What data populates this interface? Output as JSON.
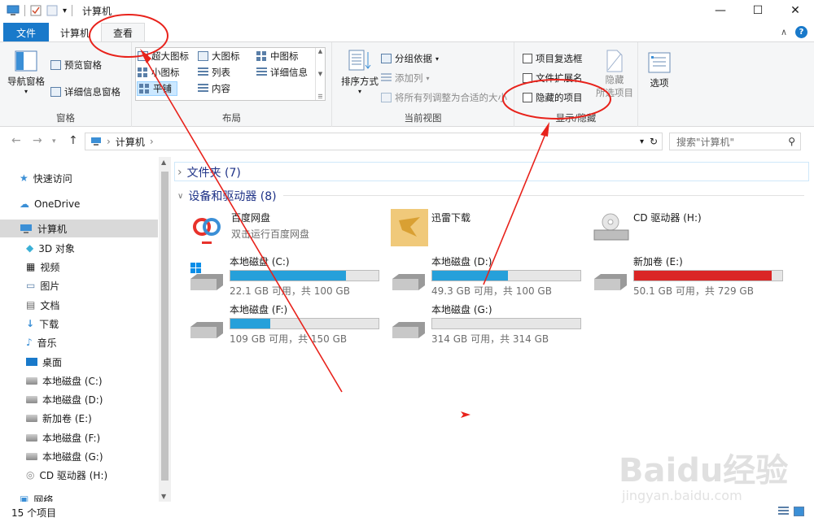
{
  "window": {
    "title": "计算机",
    "minimize": "—",
    "maximize": "☐",
    "close": "✕"
  },
  "tabs": {
    "file": "文件",
    "computer": "计算机",
    "view": "查看"
  },
  "ribbon": {
    "pane_group": {
      "nav_pane": "导航窗格",
      "preview_pane": "预览窗格",
      "details_pane": "详细信息窗格",
      "label": "窗格"
    },
    "layout_group": {
      "items": [
        "超大图标",
        "大图标",
        "中图标",
        "小图标",
        "列表",
        "详细信息",
        "平铺",
        "内容"
      ],
      "label": "布局"
    },
    "current_view_group": {
      "sort_by": "排序方式",
      "group_by": "分组依据",
      "add_columns": "添加列",
      "size_all_columns": "将所有列调整为合适的大小",
      "label": "当前视图"
    },
    "show_hide_group": {
      "item_checkboxes": "项目复选框",
      "file_extensions": "文件扩展名",
      "hidden_items": "隐藏的项目",
      "hide_selected": "隐藏",
      "selected_items": "所选项目",
      "label": "显示/隐藏"
    },
    "options": "选项"
  },
  "address": {
    "path": "计算机",
    "search_placeholder": "搜索\"计算机\""
  },
  "nav": {
    "items": [
      "快速访问",
      "OneDrive",
      "计算机",
      "3D 对象",
      "视频",
      "图片",
      "文档",
      "下载",
      "音乐",
      "桌面",
      "本地磁盘 (C:)",
      "本地磁盘 (D:)",
      "新加卷 (E:)",
      "本地磁盘 (F:)",
      "本地磁盘 (G:)",
      "CD 驱动器 (H:)",
      "网络"
    ]
  },
  "content": {
    "folders_header": "文件夹 (7)",
    "devices_header": "设备和驱动器 (8)",
    "baidu": {
      "name": "百度网盘",
      "sub": "双击运行百度网盘"
    },
    "xunlei": {
      "name": "迅雷下载"
    },
    "cd": {
      "name": "CD 驱动器 (H:)"
    },
    "drives": [
      {
        "name": "本地磁盘 (C:)",
        "sub": "22.1 GB 可用，共 100 GB",
        "used_fraction": 0.78
      },
      {
        "name": "本地磁盘 (D:)",
        "sub": "49.3 GB 可用，共 100 GB",
        "used_fraction": 0.51
      },
      {
        "name": "新加卷 (E:)",
        "sub": "50.1 GB 可用，共 729 GB",
        "used_fraction": 0.93
      },
      {
        "name": "本地磁盘 (F:)",
        "sub": "109 GB 可用，共 150 GB",
        "used_fraction": 0.27
      },
      {
        "name": "本地磁盘 (G:)",
        "sub": "314 GB 可用，共 314 GB",
        "used_fraction": 0.0
      }
    ]
  },
  "status": {
    "count": "15 个项目"
  },
  "watermark": {
    "brand": "Baidu经验",
    "url": "jingyan.baidu.com"
  },
  "colors": {
    "accent": "#1979ca",
    "bar_blue": "#26a0da",
    "bar_red": "#da2626",
    "annotation": "#e8221b"
  }
}
